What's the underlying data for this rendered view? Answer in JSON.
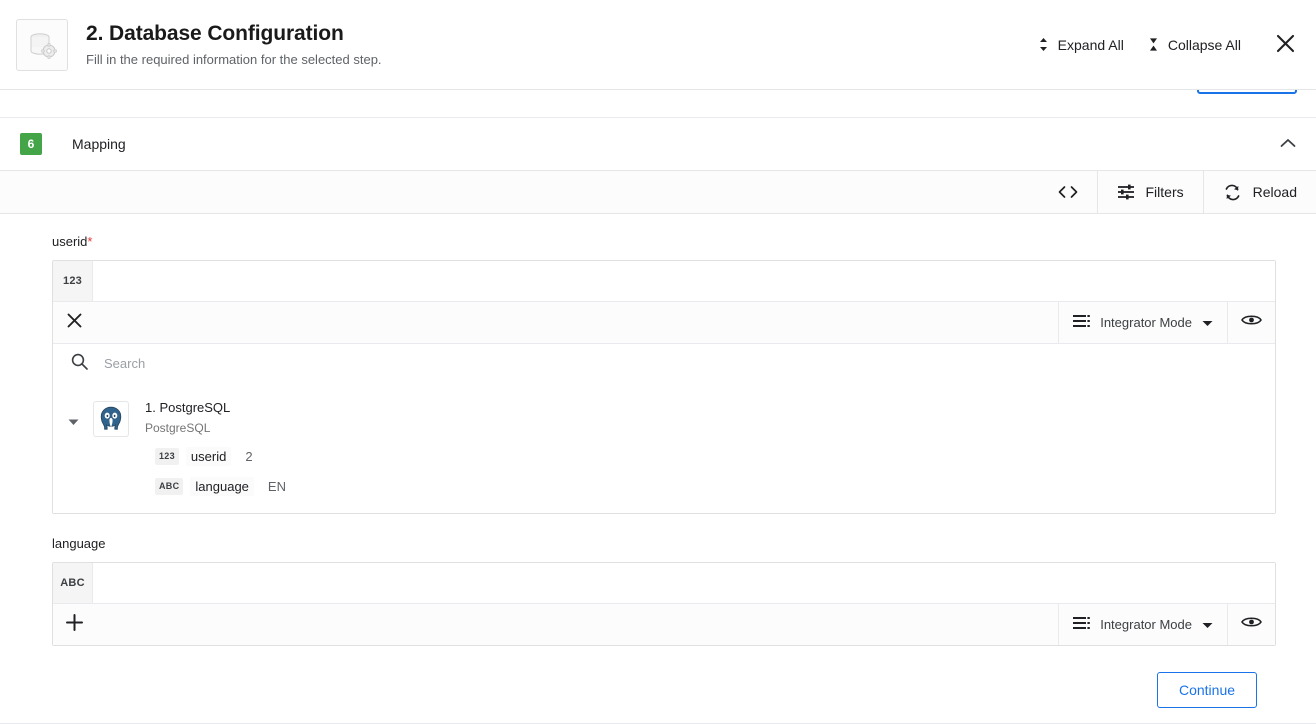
{
  "header": {
    "icon": "database-gear-icon",
    "title": "2. Database Configuration",
    "subtitle": "Fill in the required information for the selected step.",
    "expand_all_label": "Expand All",
    "collapse_all_label": "Collapse All",
    "expand_icon": "expand-chevrons-icon",
    "collapse_icon": "collapse-chevrons-icon",
    "close_icon": "close-icon"
  },
  "section": {
    "number": "6",
    "title": "Mapping",
    "chevron_icon": "chevron-up-icon",
    "badge_color": "#44a548"
  },
  "toolbar": {
    "code_icon": "code-brackets-icon",
    "code_label": "",
    "filters_label": "Filters",
    "filters_icon": "filters-sliders-icon",
    "reload_label": "Reload",
    "reload_icon": "reload-refresh-icon"
  },
  "fields": [
    {
      "label": "userid",
      "required": true,
      "type_chip": "123",
      "value": "",
      "action_icon": "close-icon",
      "mode_label": "Integrator Mode",
      "mode_icon": "list-lines-icon",
      "mode_caret_icon": "caret-down-icon",
      "eye_icon": "eye-icon",
      "expanded": true
    },
    {
      "label": "language",
      "required": false,
      "type_chip": "ABC",
      "value": "",
      "action_icon": "plus-icon",
      "mode_label": "Integrator Mode",
      "mode_icon": "list-lines-icon",
      "mode_caret_icon": "caret-down-icon",
      "eye_icon": "eye-icon",
      "expanded": false
    }
  ],
  "picker": {
    "search_placeholder": "Search",
    "search_value": "",
    "search_icon": "search-icon",
    "tree": {
      "arrow_icon": "triangle-down-icon",
      "logo_icon": "postgresql-elephant-icon",
      "node_title": "1. PostgreSQL",
      "node_subtitle": "PostgreSQL",
      "properties": [
        {
          "type": "123",
          "name": "userid",
          "value": "2"
        },
        {
          "type": "ABC",
          "name": "language",
          "value": "EN"
        }
      ]
    }
  },
  "footer": {
    "continue_label": "Continue",
    "accent_color": "#1a73e8"
  }
}
